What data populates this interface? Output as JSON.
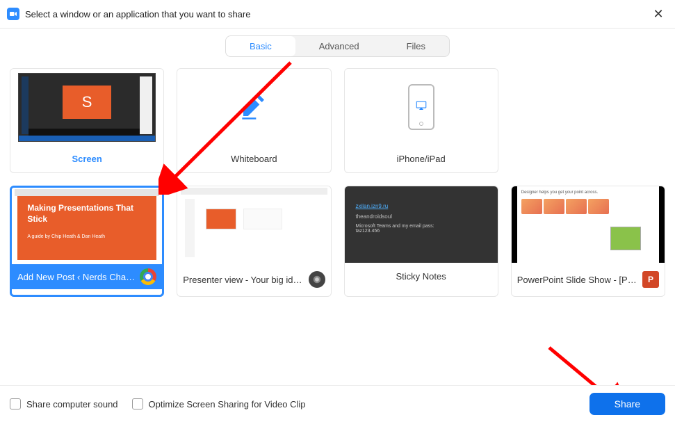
{
  "titlebar": {
    "text": "Select a window or an application that you want to share"
  },
  "tabs": {
    "basic": "Basic",
    "advanced": "Advanced",
    "files": "Files"
  },
  "tiles": {
    "screen": {
      "label": "Screen",
      "preview_letter": "S"
    },
    "whiteboard": {
      "label": "Whiteboard"
    },
    "iphone": {
      "label": "iPhone/iPad"
    },
    "chrome": {
      "label": "Add New Post ‹ Nerds Chalk — ...",
      "slide_title": "Making Presentations That Stick",
      "slide_sub": "A guide by Chip Heath & Dan Heath"
    },
    "presenter": {
      "label": "Presenter view - Your big idea - G..."
    },
    "sticky": {
      "label": "Sticky Notes",
      "link": "zxilan.izn9.ru",
      "line2": "theandroidsoul",
      "line3": "Microsoft Teams and my email pass:",
      "line4": "taz123.456"
    },
    "ppt": {
      "label": "PowerPoint Slide Show - [Present...",
      "heading": "Designer helps you get your point across."
    }
  },
  "footer": {
    "share_sound": "Share computer sound",
    "optimize": "Optimize Screen Sharing for Video Clip",
    "share_btn": "Share"
  },
  "colors": {
    "accent": "#2d8cff",
    "primary_btn": "#0e71eb",
    "orange": "#e85d2a"
  }
}
